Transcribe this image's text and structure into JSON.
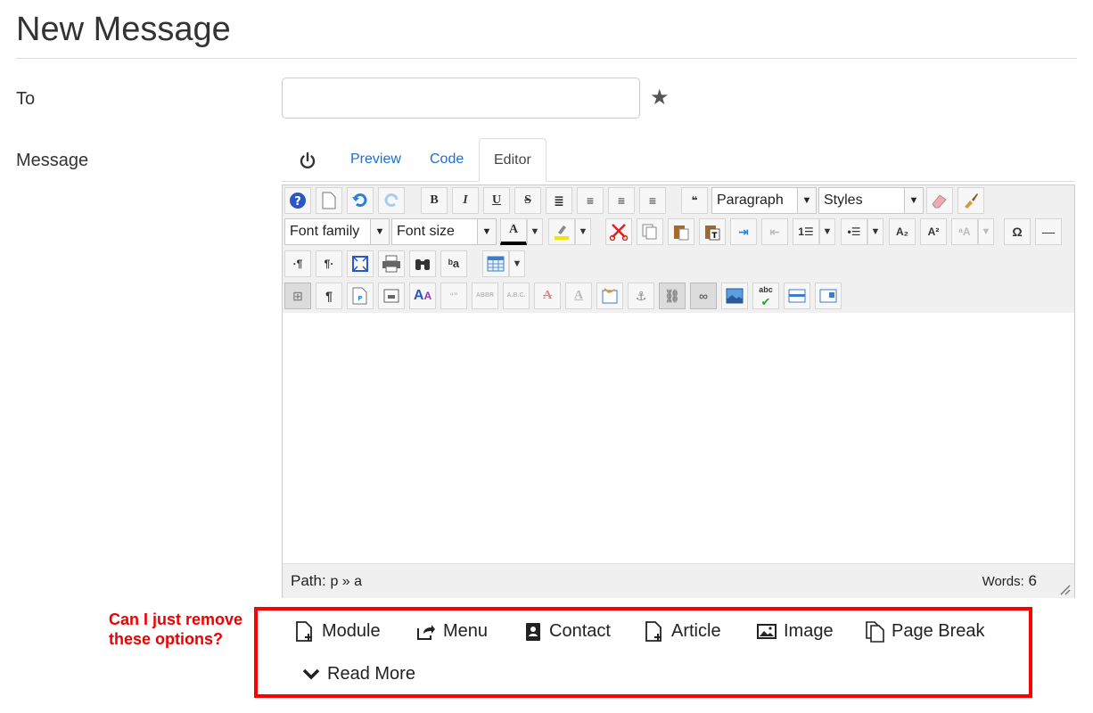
{
  "page": {
    "title": "New Message"
  },
  "form": {
    "to_label": "To",
    "to_value": "",
    "message_label": "Message"
  },
  "tabs": [
    {
      "label": "Preview"
    },
    {
      "label": "Code"
    },
    {
      "label": "Editor",
      "active": true
    }
  ],
  "toolbar": {
    "paragraph": "Paragraph",
    "styles": "Styles",
    "font_family": "Font family",
    "font_size": "Font size",
    "icons": [
      "help-icon",
      "new-document-icon",
      "undo-icon",
      "redo-icon",
      "bold-icon",
      "italic-icon",
      "underline-icon",
      "strikethrough-icon",
      "justify-icon",
      "align-center-icon",
      "align-left-icon",
      "align-right-icon",
      "blockquote-icon",
      "eraser-icon",
      "format-brush-icon",
      "text-color-icon",
      "highlight-icon",
      "cut-icon",
      "copy-icon",
      "paste-icon",
      "paste-text-icon",
      "indent-icon",
      "outdent-icon",
      "ordered-list-icon",
      "bullet-list-icon",
      "subscript-icon",
      "superscript-icon",
      "character-map-icon",
      "omega-icon",
      "horizontal-rule-icon",
      "ltr-icon",
      "rtl-icon",
      "fullscreen-icon",
      "print-icon",
      "search-icon",
      "replace-icon",
      "table-icon",
      "visual-aid-icon",
      "paragraph-mark-icon",
      "template-icon",
      "media-icon",
      "font-style-icon",
      "citation-icon",
      "abbreviation-icon",
      "acronym-icon",
      "deletion-icon",
      "insertion-icon",
      "attributes-icon",
      "anchor-icon",
      "unlink-icon",
      "link-icon",
      "image-icon",
      "spellcheck-icon",
      "layer-icon",
      "frame-icon"
    ]
  },
  "status": {
    "path_label": "Path:",
    "path_value": "p » a",
    "words_label": "Words:",
    "words_value": "6"
  },
  "annotation": {
    "text": "Can I just remove these options?"
  },
  "buttons": [
    {
      "label": "Module"
    },
    {
      "label": "Menu"
    },
    {
      "label": "Contact"
    },
    {
      "label": "Article"
    },
    {
      "label": "Image"
    },
    {
      "label": "Page Break"
    },
    {
      "label": "Read More"
    }
  ],
  "colors": {
    "link": "#1b6fd1",
    "annotation": "#ee0000",
    "highlight_box": "#ff0000"
  }
}
